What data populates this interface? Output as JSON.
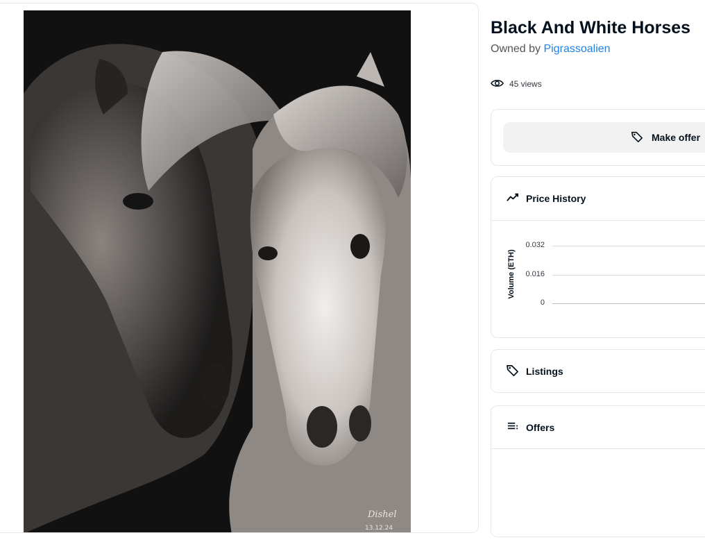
{
  "item": {
    "title": "Black And White Horses",
    "owned_by_prefix": "Owned by",
    "owner_name": "Pigrassoalien",
    "views": "45 views",
    "artist_signature": "Dishel",
    "signature_date": "13.12.24"
  },
  "actions": {
    "make_offer_label": "Make offer"
  },
  "price_history": {
    "heading": "Price History",
    "y_axis_label": "Volume (ETH)",
    "ticks": [
      "0.032",
      "0.016",
      "0"
    ]
  },
  "chart_data": {
    "type": "line",
    "title": "Price History",
    "ylabel": "Volume (ETH)",
    "yticks": [
      0.032,
      0.016,
      0
    ],
    "ylim": [
      0,
      0.032
    ],
    "series": [],
    "grid": true
  },
  "listings": {
    "heading": "Listings"
  },
  "offers": {
    "heading": "Offers"
  },
  "colors": {
    "link": "#2081e2",
    "text": "#04111d",
    "border": "#e5e8eb",
    "button_bg": "#f2f2f2"
  },
  "icons": {
    "views": "eye-icon",
    "make_offer": "tag-icon",
    "price_history": "trend-line-icon",
    "listings": "tag-icon",
    "offers": "list-icon"
  }
}
